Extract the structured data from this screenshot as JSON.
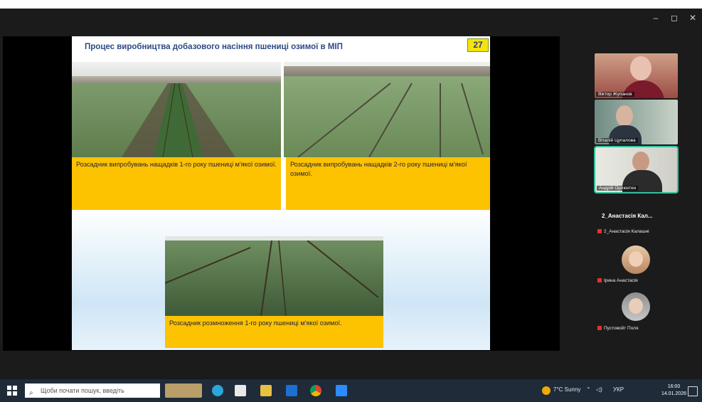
{
  "window_controls": {
    "minimize": "–",
    "restore": "◻",
    "close": "✕"
  },
  "slide": {
    "title": "Процес виробництва добазового насіння пшениці озимої в МІП",
    "number": "27",
    "captions": [
      "Розсадник випробувань нащадків 1-го року пшениці м'якої озимої.",
      "Розсадник випробувань нащадків 2-го року пшениці м'якої озимої.",
      "Розсадник розмноження 1-го року пшениці м'якої озимої."
    ]
  },
  "participants": {
    "tiles": [
      {
        "name": "Віктор Жупанов"
      },
      {
        "name": "Віталій Цупалова"
      },
      {
        "name": "Андрій Орлюктен"
      }
    ],
    "section_title": "2_Анастасія Кал...",
    "list": [
      {
        "name": "2_Анастасія Калашні"
      },
      {
        "name": "Ірина Анастасія"
      },
      {
        "name": "Пустовойт Поля"
      }
    ]
  },
  "taskbar": {
    "search_placeholder": "Щоби почати пошук, введіть",
    "weather": "7°C Sunny",
    "lang": "УКР",
    "time": "16:00",
    "date": "14.01.2026"
  }
}
